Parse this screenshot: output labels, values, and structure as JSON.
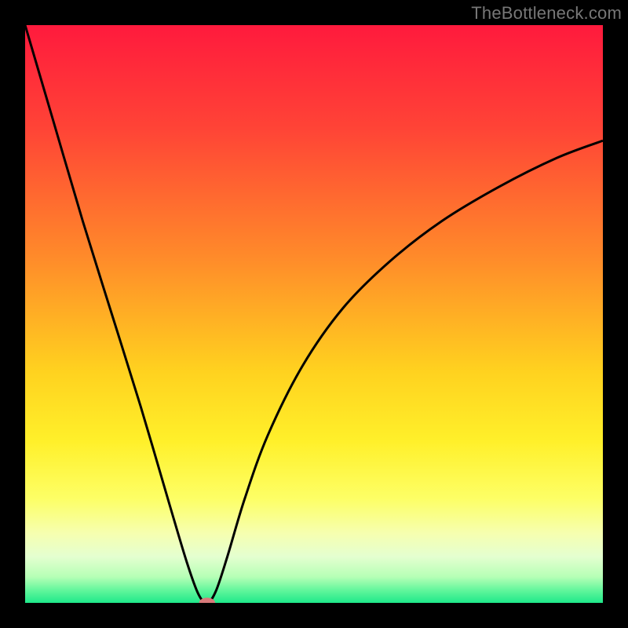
{
  "attribution": "TheBottleneck.com",
  "chart_data": {
    "type": "line",
    "title": "",
    "xlabel": "",
    "ylabel": "",
    "xlim": [
      0,
      100
    ],
    "ylim": [
      0,
      100
    ],
    "grid": false,
    "legend": false,
    "series": [
      {
        "name": "bottleneck-curve",
        "x": [
          0,
          5,
          10,
          15,
          20,
          25,
          28,
          30,
          31.5,
          33,
          35,
          38,
          42,
          48,
          55,
          63,
          72,
          82,
          92,
          100
        ],
        "values": [
          100,
          83,
          66,
          50,
          34,
          17,
          7,
          1.5,
          0,
          2,
          8,
          18,
          29,
          41,
          51,
          59,
          66,
          72,
          77,
          80
        ]
      }
    ],
    "marker": {
      "name": "optimal-point",
      "x": 31.5,
      "y": 0,
      "rx": 1.4,
      "ry": 0.9,
      "color": "#d97a7a"
    },
    "background_gradient": {
      "stops": [
        {
          "offset": 0.0,
          "color": "#ff1a3d"
        },
        {
          "offset": 0.18,
          "color": "#ff4436"
        },
        {
          "offset": 0.4,
          "color": "#ff8a2a"
        },
        {
          "offset": 0.6,
          "color": "#ffd21f"
        },
        {
          "offset": 0.72,
          "color": "#fff02a"
        },
        {
          "offset": 0.82,
          "color": "#fdff66"
        },
        {
          "offset": 0.88,
          "color": "#f6ffb0"
        },
        {
          "offset": 0.92,
          "color": "#e4ffd0"
        },
        {
          "offset": 0.955,
          "color": "#b6ffb6"
        },
        {
          "offset": 0.98,
          "color": "#5cf59a"
        },
        {
          "offset": 1.0,
          "color": "#1fe88a"
        }
      ]
    },
    "curve_color": "#000000",
    "curve_width": 3
  }
}
